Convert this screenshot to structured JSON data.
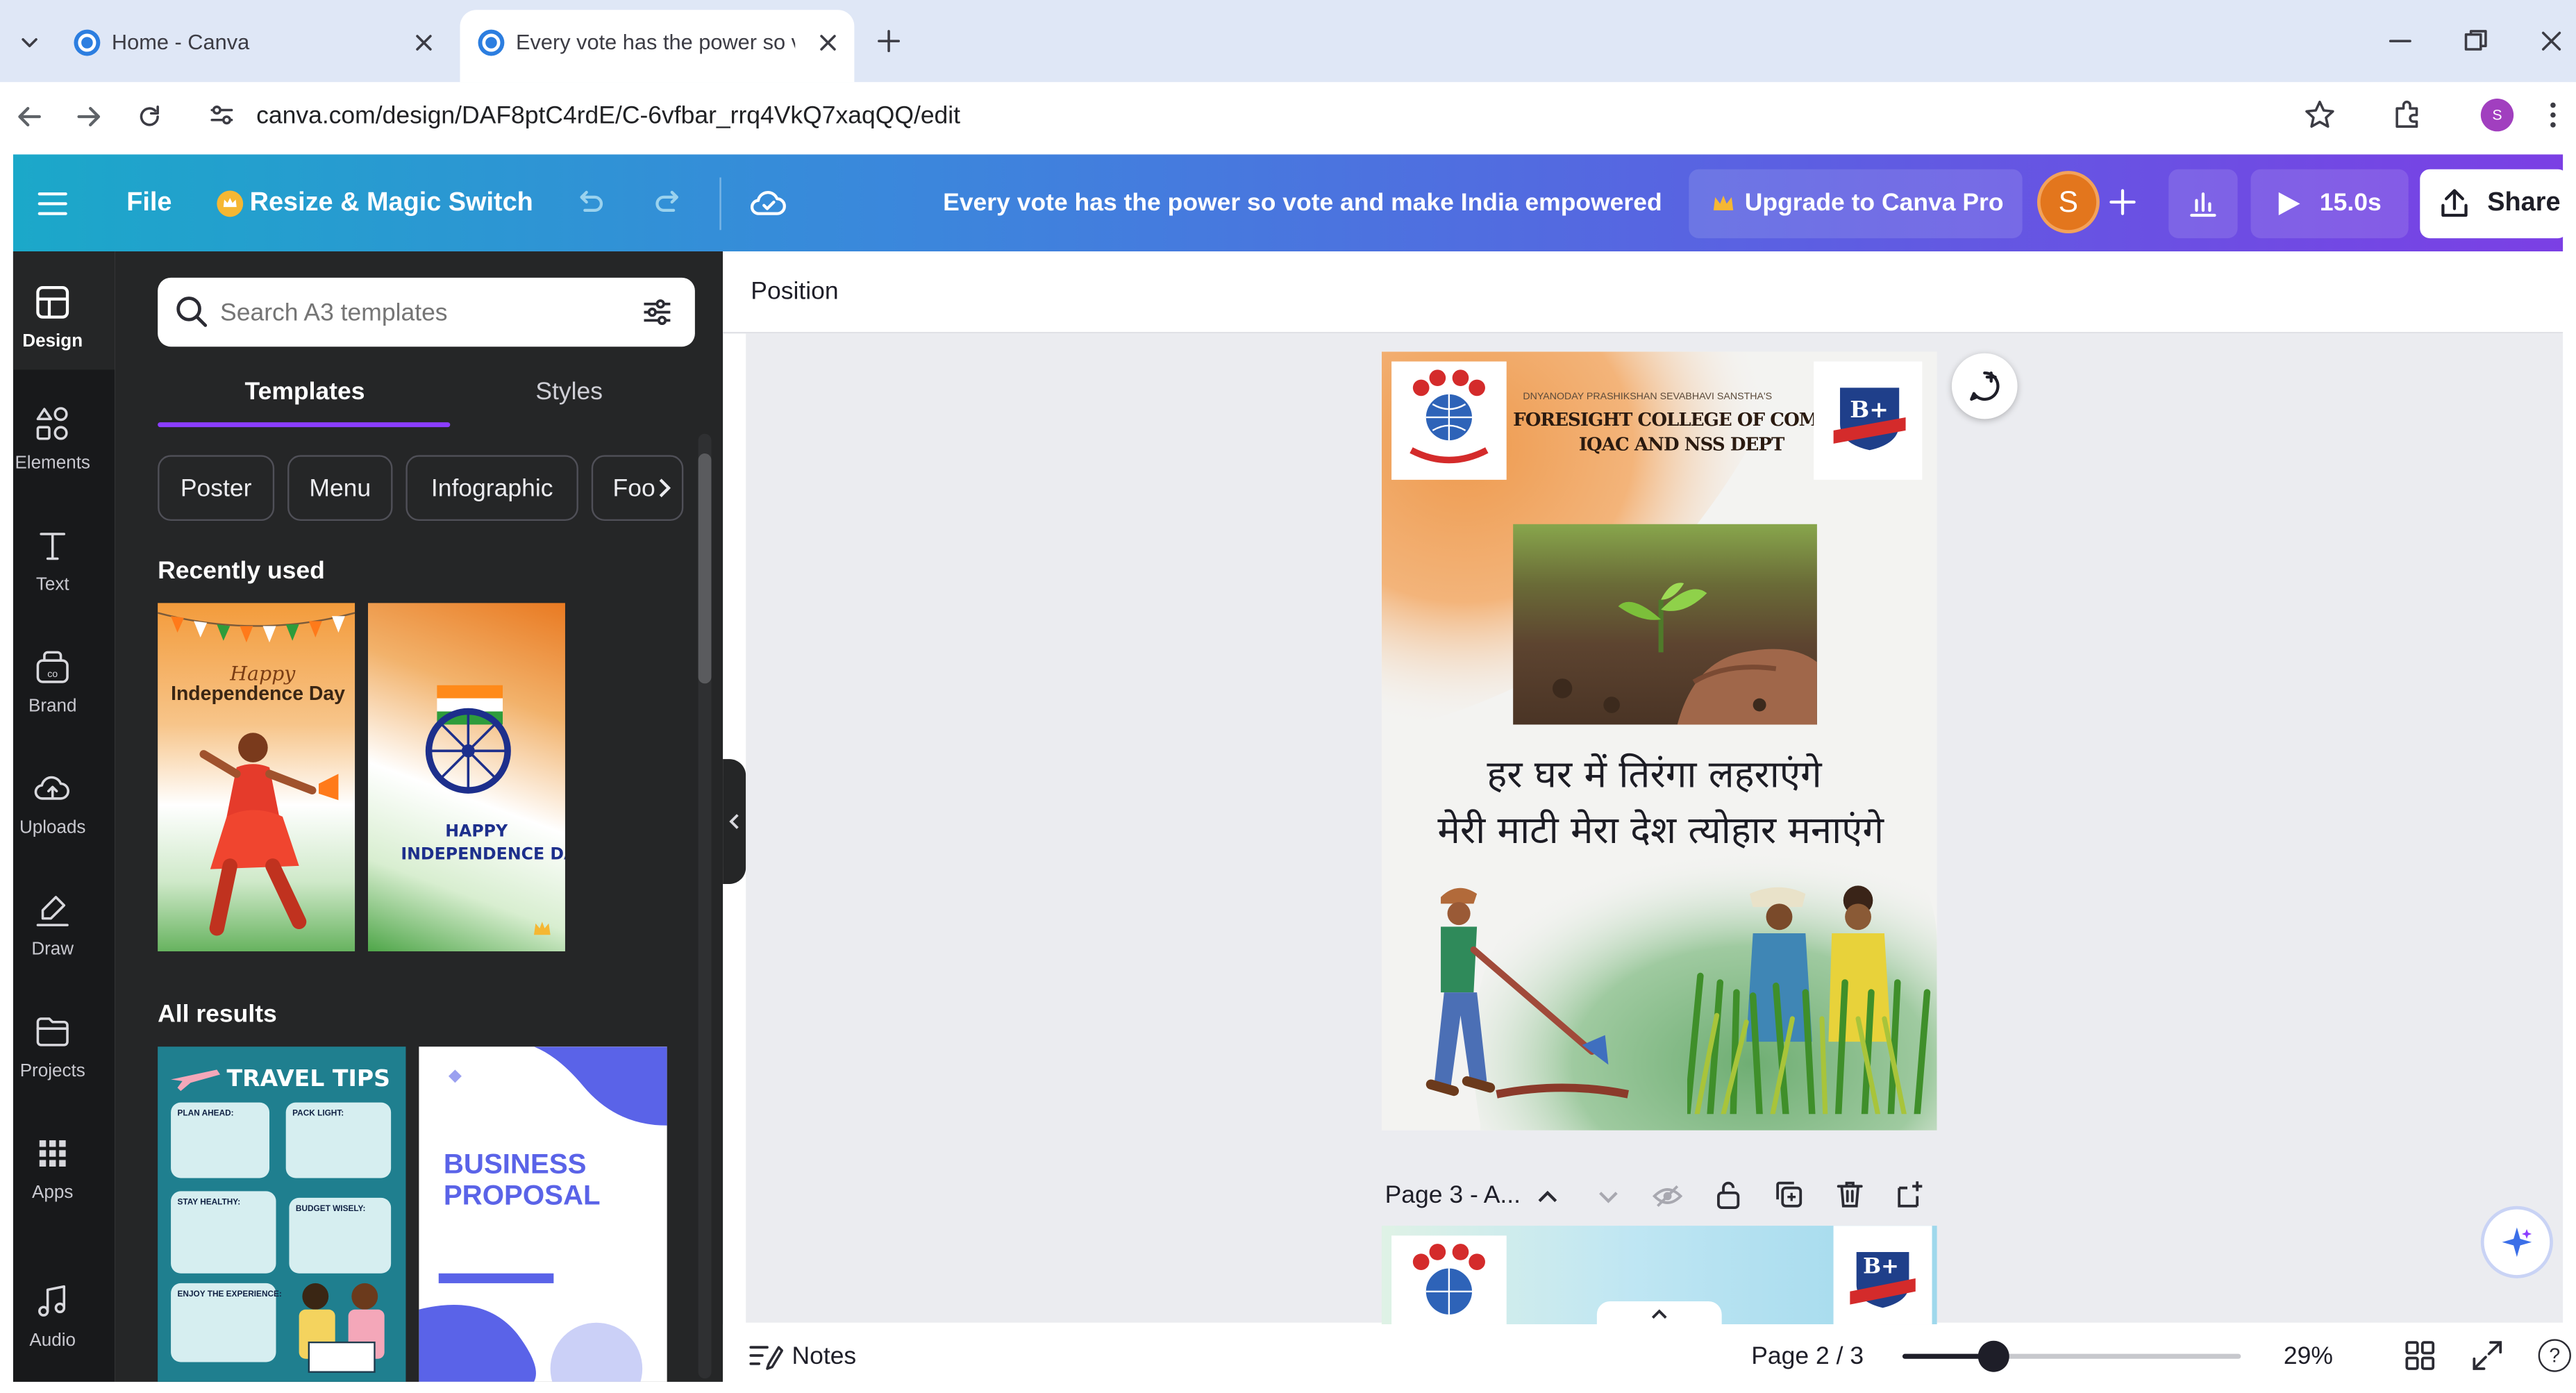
{
  "browser": {
    "tabs": [
      {
        "title": "Home - Canva",
        "active": false
      },
      {
        "title": "Every vote has the power so vo",
        "active": true
      }
    ],
    "url": "canva.com/design/DAF8ptC4rdE/C-6vfbar_rrq4VkQ7xaqQQ/edit",
    "profile_initial": "S"
  },
  "toolbar": {
    "file_label": "File",
    "resize_label": "Resize & Magic Switch",
    "design_title": "Every vote has the power so vote and make India empowered",
    "upgrade_label": "Upgrade to Canva Pro",
    "user_initial": "S",
    "play_duration": "15.0s",
    "share_label": "Share"
  },
  "rail": {
    "items": [
      {
        "label": "Design",
        "icon": "design-icon"
      },
      {
        "label": "Elements",
        "icon": "elements-icon"
      },
      {
        "label": "Text",
        "icon": "text-icon"
      },
      {
        "label": "Brand",
        "icon": "brand-icon"
      },
      {
        "label": "Uploads",
        "icon": "uploads-icon"
      },
      {
        "label": "Draw",
        "icon": "draw-icon"
      },
      {
        "label": "Projects",
        "icon": "projects-icon"
      },
      {
        "label": "Apps",
        "icon": "apps-icon"
      },
      {
        "label": "Audio",
        "icon": "audio-icon"
      }
    ]
  },
  "panel": {
    "search_placeholder": "Search A3 templates",
    "tabs": [
      "Templates",
      "Styles"
    ],
    "chips": [
      "Poster",
      "Menu",
      "Infographic",
      "Foo"
    ],
    "recent_heading": "Recently used",
    "recent": [
      {
        "line1": "Happy",
        "line2": "Independence Day"
      },
      {
        "line1": "HAPPY",
        "line2": "INDEPENDENCE DAY"
      }
    ],
    "results_heading": "All results",
    "results": [
      {
        "title": "TRAVEL TIPS",
        "labels": [
          "PLAN AHEAD:",
          "PACK LIGHT:",
          "STAY HEALTHY:",
          "BUDGET WISELY:",
          "ENJOY THE EXPERIENCE:"
        ]
      },
      {
        "title_line1": "BUSINESS",
        "title_line2": "PROPOSAL"
      }
    ]
  },
  "canvas": {
    "context_label": "Position",
    "poster": {
      "org_line": "DNYANODAY PRASHIKSHAN SEVABHAVI SANSTHA'S",
      "college": "FORESIGHT COLLEGE OF COMMERCE",
      "dept": "IQAC AND NSS DEPT",
      "naac_badge": "B+",
      "hindi_line1": "हर घर में तिरंगा लहराएंगे",
      "hindi_line2": "मेरी माटी मेरा देश त्योहार मनाएंगे"
    },
    "page_label": "Page 3 - A..."
  },
  "statusbar": {
    "notes_label": "Notes",
    "page_indicator": "Page 2 / 3",
    "zoom": "29%",
    "zoom_fraction": 0.29
  },
  "colors": {
    "toolbar_gradient_start": "#1ba8c9",
    "toolbar_gradient_end": "#7b3fe4",
    "sidebar_bg": "#18191b",
    "panel_bg": "#252627",
    "canvas_bg": "#ebecf0",
    "accent_purple": "#8b3dff"
  }
}
